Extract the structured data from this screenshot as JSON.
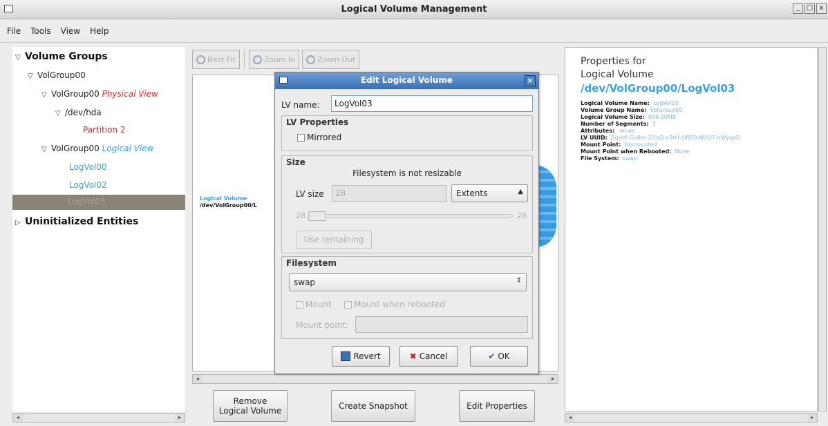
{
  "window": {
    "title": "Logical Volume Management",
    "buttons": [
      "_",
      "□",
      "x"
    ]
  },
  "menu": [
    {
      "label": "File",
      "key": "F"
    },
    {
      "label": "Tools",
      "key": "T"
    },
    {
      "label": "View",
      "key": "V"
    },
    {
      "label": "Help",
      "key": "H"
    }
  ],
  "tree": {
    "volume_groups": "Volume Groups",
    "volgroup": "VolGroup00",
    "physical_prefix": "VolGroup00",
    "physical_view": "Physical View",
    "dev": "/dev/hda",
    "partition": "Partition 2",
    "logical_prefix": "VolGroup00",
    "logical_view": "Logical View",
    "lv0": "LogVol00",
    "lv2": "LogVol02",
    "lv3": "LogVol03",
    "uninit": "Uninitialized Entities"
  },
  "toolbar": {
    "best_fit": "Best Fit",
    "zoom_in": "Zoom In",
    "zoom_out": "Zoom Out"
  },
  "canvas": {
    "lv_label": "Logical Volume",
    "lv_path": "/dev/VolGroup00/L"
  },
  "actions": {
    "remove": "Remove Logical Volume",
    "snapshot": "Create Snapshot",
    "edit": "Edit Properties"
  },
  "properties": {
    "heading1": "Properties for",
    "heading2": "Logical Volume",
    "path": "/dev/VolGroup00/LogVol03",
    "rows": [
      {
        "k": "Logical Volume Name:",
        "v": "LogVol03"
      },
      {
        "k": "Volume Group Name:",
        "v": "VolGroup00"
      },
      {
        "k": "Logical Volume Size:",
        "v": "896.00MB"
      },
      {
        "k": "Number of Segments:",
        "v": "1"
      },
      {
        "k": "Attributes:",
        "v": "-wi-ao"
      },
      {
        "k": "LV UUID:",
        "v": "Zqsrtl-Gu8m-2OvO-n3rH-dW03-NUQ7-nWyqxD"
      },
      {
        "k": "Mount Point:",
        "v": "Unmounted"
      },
      {
        "k": "Mount Point when Rebooted:",
        "v": "None"
      },
      {
        "k": "File System:",
        "v": "swap"
      }
    ]
  },
  "dialog": {
    "title": "Edit Logical Volume",
    "lv_name_label": "LV name:",
    "lv_name_value": "LogVol03",
    "lv_properties": "LV Properties",
    "mirrored": "Mirrored",
    "size_group": "Size",
    "not_resizable": "Filesystem is not resizable",
    "lv_size_label": "LV size",
    "lv_size_value": "28",
    "unit": "Extents",
    "slider_min": "28",
    "slider_max": "28",
    "slider_value_fraction": 0,
    "use_remaining": "Use remaining",
    "filesystem_group": "Filesystem",
    "filesystem": "swap",
    "mount": "Mount",
    "mount_rebooted": "Mount when rebooted",
    "mount_point_label": "Mount point:",
    "mount_point_value": "",
    "revert": "Revert",
    "cancel": "Cancel",
    "ok": "OK"
  }
}
